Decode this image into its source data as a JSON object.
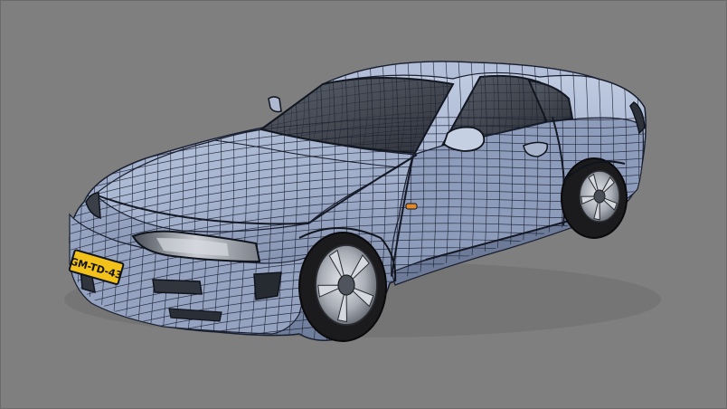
{
  "viewport": {
    "background": "#7f7f7f"
  },
  "model": {
    "subject": "car-wireframe-render",
    "body_color": "#9aa9c7",
    "body_highlight": "#c2cde3",
    "body_shadow": "#5d6b8a",
    "wire_color": "#1a2030",
    "glass_color": "#3e434d",
    "tire_color": "#1b1b1d",
    "rim_color": "#bcc0c8",
    "plate_color": "#f2c21a",
    "indicator_color": "#e08a2a"
  },
  "license_plate": {
    "text": "GM-TD-43"
  }
}
